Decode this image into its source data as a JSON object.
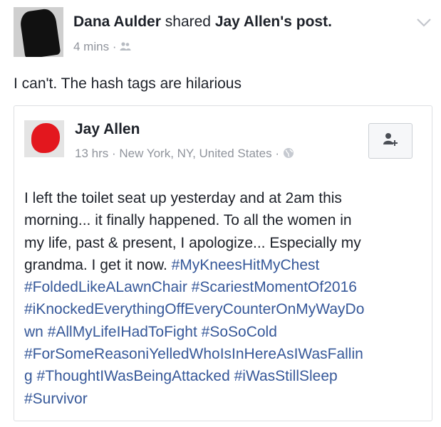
{
  "post": {
    "author": "Dana Aulder",
    "action": "shared",
    "shared_from": "Jay Allen",
    "post_suffix": "'s post.",
    "time": "4 mins",
    "separator": "·",
    "audience_icon": "friends-icon",
    "menu_icon": "chevron-down-icon",
    "caption": "I can't. The hash tags are hilarious"
  },
  "shared_post": {
    "author": "Jay Allen",
    "time": "13 hrs",
    "separator": "·",
    "location": "New York, NY, United States",
    "separator2": "·",
    "audience_icon": "globe-icon",
    "add_friend_icon": "add-friend-icon",
    "lines": [
      [
        {
          "t": "I left the toilet seat up yesterday and at 2am this",
          "h": false
        }
      ],
      [
        {
          "t": "morning... it finally happened. To all the women in",
          "h": false
        }
      ],
      [
        {
          "t": "my life, past & present, I apologize... Especially my",
          "h": false
        }
      ],
      [
        {
          "t": "grandma. I get it now. ",
          "h": false
        },
        {
          "t": "#MyKneesHitMyChest",
          "h": true
        }
      ],
      [
        {
          "t": "#FoldedLikeALawnChair",
          "h": true
        },
        {
          "t": " ",
          "h": false
        },
        {
          "t": "#ScariestMomentOf2016",
          "h": true
        }
      ],
      [
        {
          "t": "#iKnockedEverythingOffEveryCounterOnMyWayDo",
          "h": true
        }
      ],
      [
        {
          "t": "wn",
          "h": true
        },
        {
          "t": " ",
          "h": false
        },
        {
          "t": "#AllMyLifeIHadToFight",
          "h": true
        },
        {
          "t": " ",
          "h": false
        },
        {
          "t": "#SoSoCold",
          "h": true
        }
      ],
      [
        {
          "t": "#ForSomeReasoniYelledWhoIsInHereAsIWasFallin",
          "h": true
        }
      ],
      [
        {
          "t": "g",
          "h": true
        },
        {
          "t": " ",
          "h": false
        },
        {
          "t": "#ThoughtIWasBeingAttacked",
          "h": true
        },
        {
          "t": " ",
          "h": false
        },
        {
          "t": "#iWasStillSleep",
          "h": true
        }
      ],
      [
        {
          "t": "#Survivor",
          "h": true
        }
      ]
    ]
  },
  "colors": {
    "text": "#1d2129",
    "meta": "#90949c",
    "hashtag": "#365899",
    "border": "#dddfe2"
  }
}
